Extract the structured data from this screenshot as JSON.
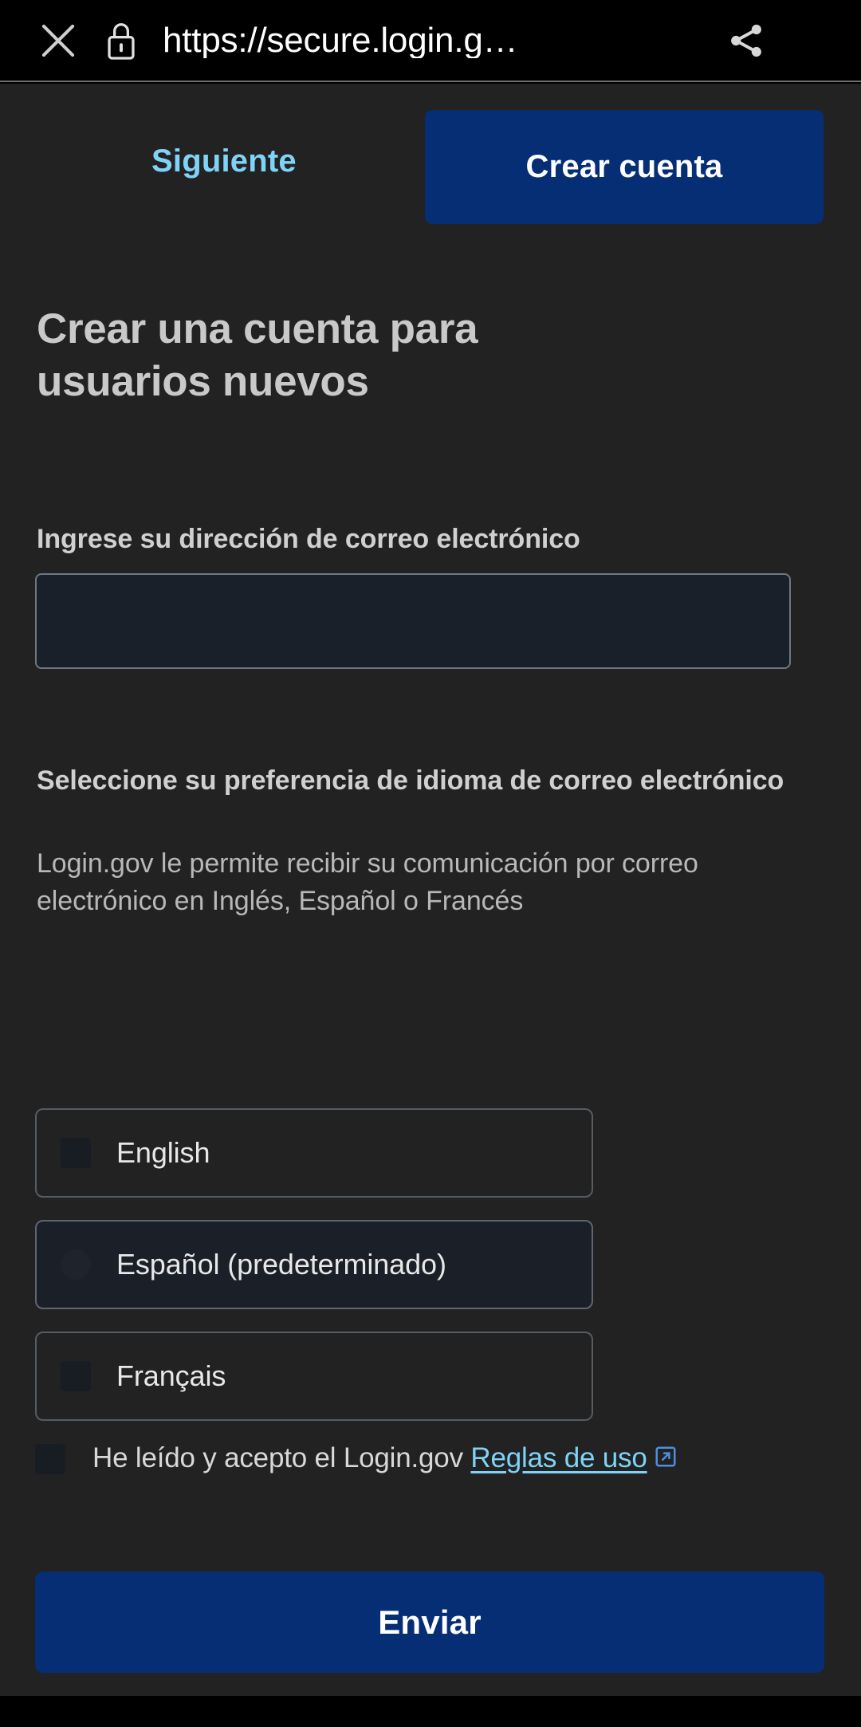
{
  "browser": {
    "url": "https://secure.login.g…",
    "close_icon": "close-icon",
    "lock_icon": "lock-icon",
    "share_icon": "share-icon",
    "menu_icon": "more-vertical-icon"
  },
  "nav": {
    "secondary_label": "Siguiente",
    "primary_label": "Crear cuenta"
  },
  "page": {
    "heading": "Crear una cuenta para usuarios nuevos"
  },
  "email": {
    "label": "Ingrese su dirección de correo electrónico",
    "value": "",
    "placeholder": ""
  },
  "language": {
    "heading": "Seleccione su preferencia de idioma de correo electrónico",
    "description": "Login.gov le permite recibir su comunicación por correo electrónico en Inglés, Español o Francés",
    "options": [
      {
        "label": "English",
        "selected": false
      },
      {
        "label": "Español (predeterminado)",
        "selected": true
      },
      {
        "label": "Français",
        "selected": false
      }
    ]
  },
  "terms": {
    "checked": false,
    "text": "He leído y acepto el Login.gov",
    "link_label": "Reglas de uso",
    "external_icon": "external-link-icon"
  },
  "submit": {
    "label": "Enviar"
  },
  "colors": {
    "chrome_background": "#000000",
    "page_background": "#222222",
    "primary_button": "#062e75",
    "link_accent": "#7fd3f7",
    "input_fill": "#1a2029",
    "input_border": "#6d7882",
    "heading_text": "#c9c9c9",
    "body_text": "#b8b8b8"
  }
}
